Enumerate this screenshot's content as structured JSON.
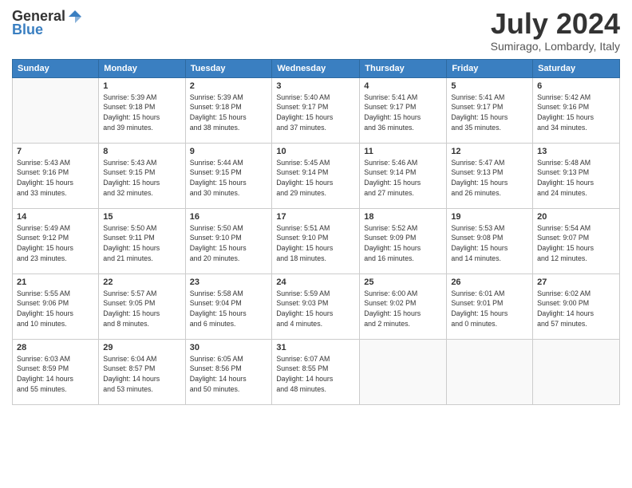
{
  "logo": {
    "general": "General",
    "blue": "Blue"
  },
  "title": "July 2024",
  "location": "Sumirago, Lombardy, Italy",
  "headers": [
    "Sunday",
    "Monday",
    "Tuesday",
    "Wednesday",
    "Thursday",
    "Friday",
    "Saturday"
  ],
  "weeks": [
    [
      {
        "day": "",
        "content": ""
      },
      {
        "day": "1",
        "content": "Sunrise: 5:39 AM\nSunset: 9:18 PM\nDaylight: 15 hours\nand 39 minutes."
      },
      {
        "day": "2",
        "content": "Sunrise: 5:39 AM\nSunset: 9:18 PM\nDaylight: 15 hours\nand 38 minutes."
      },
      {
        "day": "3",
        "content": "Sunrise: 5:40 AM\nSunset: 9:17 PM\nDaylight: 15 hours\nand 37 minutes."
      },
      {
        "day": "4",
        "content": "Sunrise: 5:41 AM\nSunset: 9:17 PM\nDaylight: 15 hours\nand 36 minutes."
      },
      {
        "day": "5",
        "content": "Sunrise: 5:41 AM\nSunset: 9:17 PM\nDaylight: 15 hours\nand 35 minutes."
      },
      {
        "day": "6",
        "content": "Sunrise: 5:42 AM\nSunset: 9:16 PM\nDaylight: 15 hours\nand 34 minutes."
      }
    ],
    [
      {
        "day": "7",
        "content": "Sunrise: 5:43 AM\nSunset: 9:16 PM\nDaylight: 15 hours\nand 33 minutes."
      },
      {
        "day": "8",
        "content": "Sunrise: 5:43 AM\nSunset: 9:15 PM\nDaylight: 15 hours\nand 32 minutes."
      },
      {
        "day": "9",
        "content": "Sunrise: 5:44 AM\nSunset: 9:15 PM\nDaylight: 15 hours\nand 30 minutes."
      },
      {
        "day": "10",
        "content": "Sunrise: 5:45 AM\nSunset: 9:14 PM\nDaylight: 15 hours\nand 29 minutes."
      },
      {
        "day": "11",
        "content": "Sunrise: 5:46 AM\nSunset: 9:14 PM\nDaylight: 15 hours\nand 27 minutes."
      },
      {
        "day": "12",
        "content": "Sunrise: 5:47 AM\nSunset: 9:13 PM\nDaylight: 15 hours\nand 26 minutes."
      },
      {
        "day": "13",
        "content": "Sunrise: 5:48 AM\nSunset: 9:13 PM\nDaylight: 15 hours\nand 24 minutes."
      }
    ],
    [
      {
        "day": "14",
        "content": "Sunrise: 5:49 AM\nSunset: 9:12 PM\nDaylight: 15 hours\nand 23 minutes."
      },
      {
        "day": "15",
        "content": "Sunrise: 5:50 AM\nSunset: 9:11 PM\nDaylight: 15 hours\nand 21 minutes."
      },
      {
        "day": "16",
        "content": "Sunrise: 5:50 AM\nSunset: 9:10 PM\nDaylight: 15 hours\nand 20 minutes."
      },
      {
        "day": "17",
        "content": "Sunrise: 5:51 AM\nSunset: 9:10 PM\nDaylight: 15 hours\nand 18 minutes."
      },
      {
        "day": "18",
        "content": "Sunrise: 5:52 AM\nSunset: 9:09 PM\nDaylight: 15 hours\nand 16 minutes."
      },
      {
        "day": "19",
        "content": "Sunrise: 5:53 AM\nSunset: 9:08 PM\nDaylight: 15 hours\nand 14 minutes."
      },
      {
        "day": "20",
        "content": "Sunrise: 5:54 AM\nSunset: 9:07 PM\nDaylight: 15 hours\nand 12 minutes."
      }
    ],
    [
      {
        "day": "21",
        "content": "Sunrise: 5:55 AM\nSunset: 9:06 PM\nDaylight: 15 hours\nand 10 minutes."
      },
      {
        "day": "22",
        "content": "Sunrise: 5:57 AM\nSunset: 9:05 PM\nDaylight: 15 hours\nand 8 minutes."
      },
      {
        "day": "23",
        "content": "Sunrise: 5:58 AM\nSunset: 9:04 PM\nDaylight: 15 hours\nand 6 minutes."
      },
      {
        "day": "24",
        "content": "Sunrise: 5:59 AM\nSunset: 9:03 PM\nDaylight: 15 hours\nand 4 minutes."
      },
      {
        "day": "25",
        "content": "Sunrise: 6:00 AM\nSunset: 9:02 PM\nDaylight: 15 hours\nand 2 minutes."
      },
      {
        "day": "26",
        "content": "Sunrise: 6:01 AM\nSunset: 9:01 PM\nDaylight: 15 hours\nand 0 minutes."
      },
      {
        "day": "27",
        "content": "Sunrise: 6:02 AM\nSunset: 9:00 PM\nDaylight: 14 hours\nand 57 minutes."
      }
    ],
    [
      {
        "day": "28",
        "content": "Sunrise: 6:03 AM\nSunset: 8:59 PM\nDaylight: 14 hours\nand 55 minutes."
      },
      {
        "day": "29",
        "content": "Sunrise: 6:04 AM\nSunset: 8:57 PM\nDaylight: 14 hours\nand 53 minutes."
      },
      {
        "day": "30",
        "content": "Sunrise: 6:05 AM\nSunset: 8:56 PM\nDaylight: 14 hours\nand 50 minutes."
      },
      {
        "day": "31",
        "content": "Sunrise: 6:07 AM\nSunset: 8:55 PM\nDaylight: 14 hours\nand 48 minutes."
      },
      {
        "day": "",
        "content": ""
      },
      {
        "day": "",
        "content": ""
      },
      {
        "day": "",
        "content": ""
      }
    ]
  ]
}
